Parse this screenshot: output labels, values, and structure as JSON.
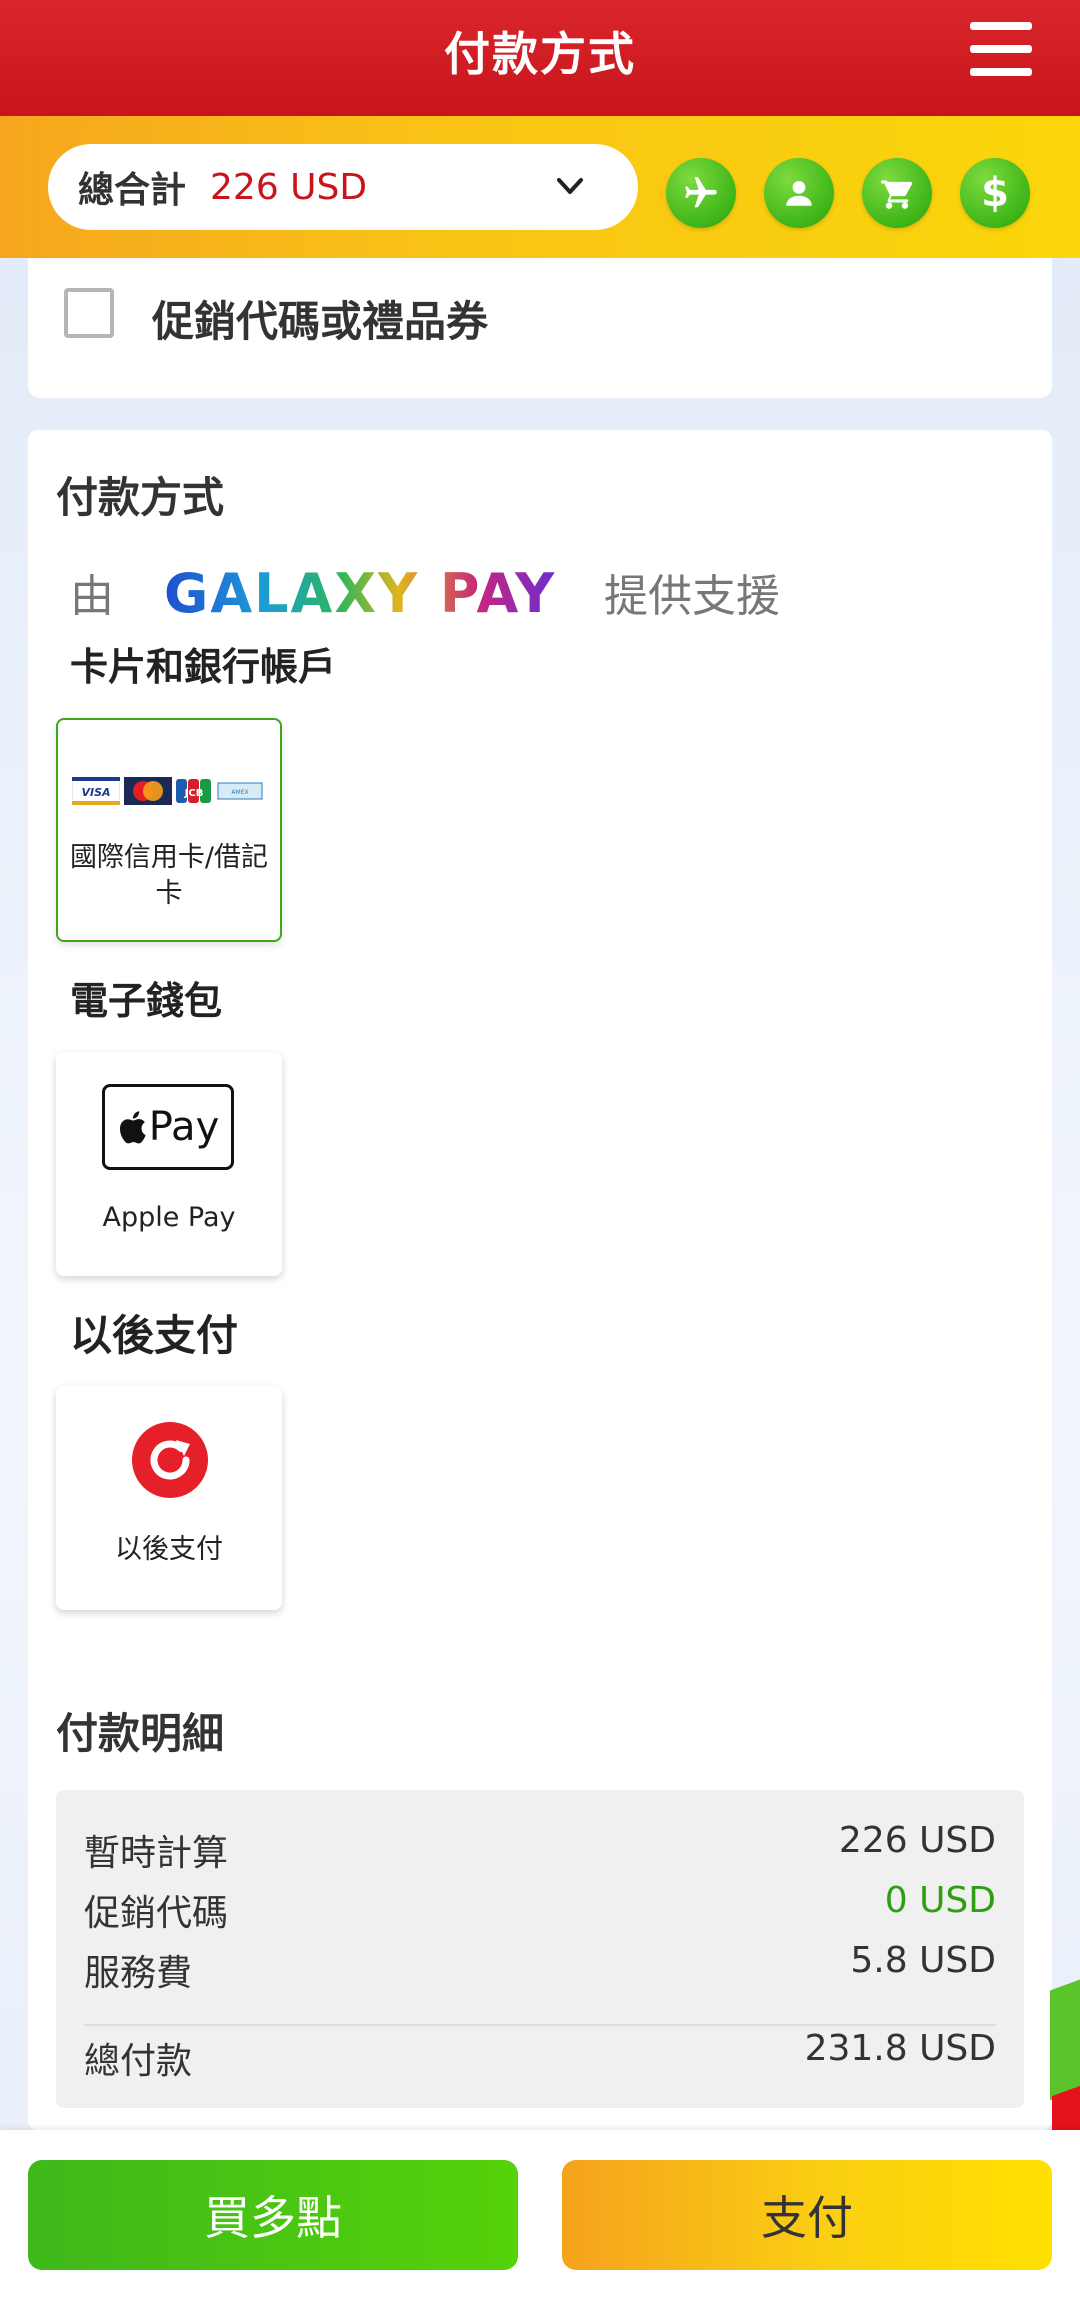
{
  "header": {
    "title": "付款方式"
  },
  "summary": {
    "total_label": "總合計",
    "total_amount": "226 USD"
  },
  "nav_icons": [
    "plane-icon",
    "user-icon",
    "cart-icon",
    "dollar-icon"
  ],
  "promo": {
    "label": "促銷代碼或禮品券",
    "checked": false
  },
  "payment": {
    "title": "付款方式",
    "powered_prefix": "由",
    "brand": "GALAXY PAY",
    "powered_suffix": "提供支援",
    "groups": {
      "cards": {
        "title": "卡片和銀行帳戶",
        "method_label": "國際信用卡/借記卡",
        "card_brands": [
          "VISA",
          "MasterCard",
          "JCB",
          "AMERICAN EXPRESS"
        ]
      },
      "wallet": {
        "title": "電子錢包",
        "method_label": "Apple Pay",
        "logo_text": "Pay"
      },
      "later": {
        "title": "以後支付",
        "method_label": "以後支付"
      }
    }
  },
  "details": {
    "title": "付款明細",
    "rows": [
      {
        "label": "暫時計算",
        "value": "226 USD"
      },
      {
        "label": "促銷代碼",
        "value": "0 USD"
      },
      {
        "label": "服務費",
        "value": "5.8 USD"
      }
    ],
    "total": {
      "label": "總付款",
      "value": "231.8 USD"
    }
  },
  "footer": {
    "more_label": "買多點",
    "pay_label": "支付"
  },
  "colors": {
    "header_red": "#c8141c",
    "accent_green": "#3fb81b",
    "accent_yellow": "#fbcf12",
    "promo_value_green": "#2e9e12"
  }
}
